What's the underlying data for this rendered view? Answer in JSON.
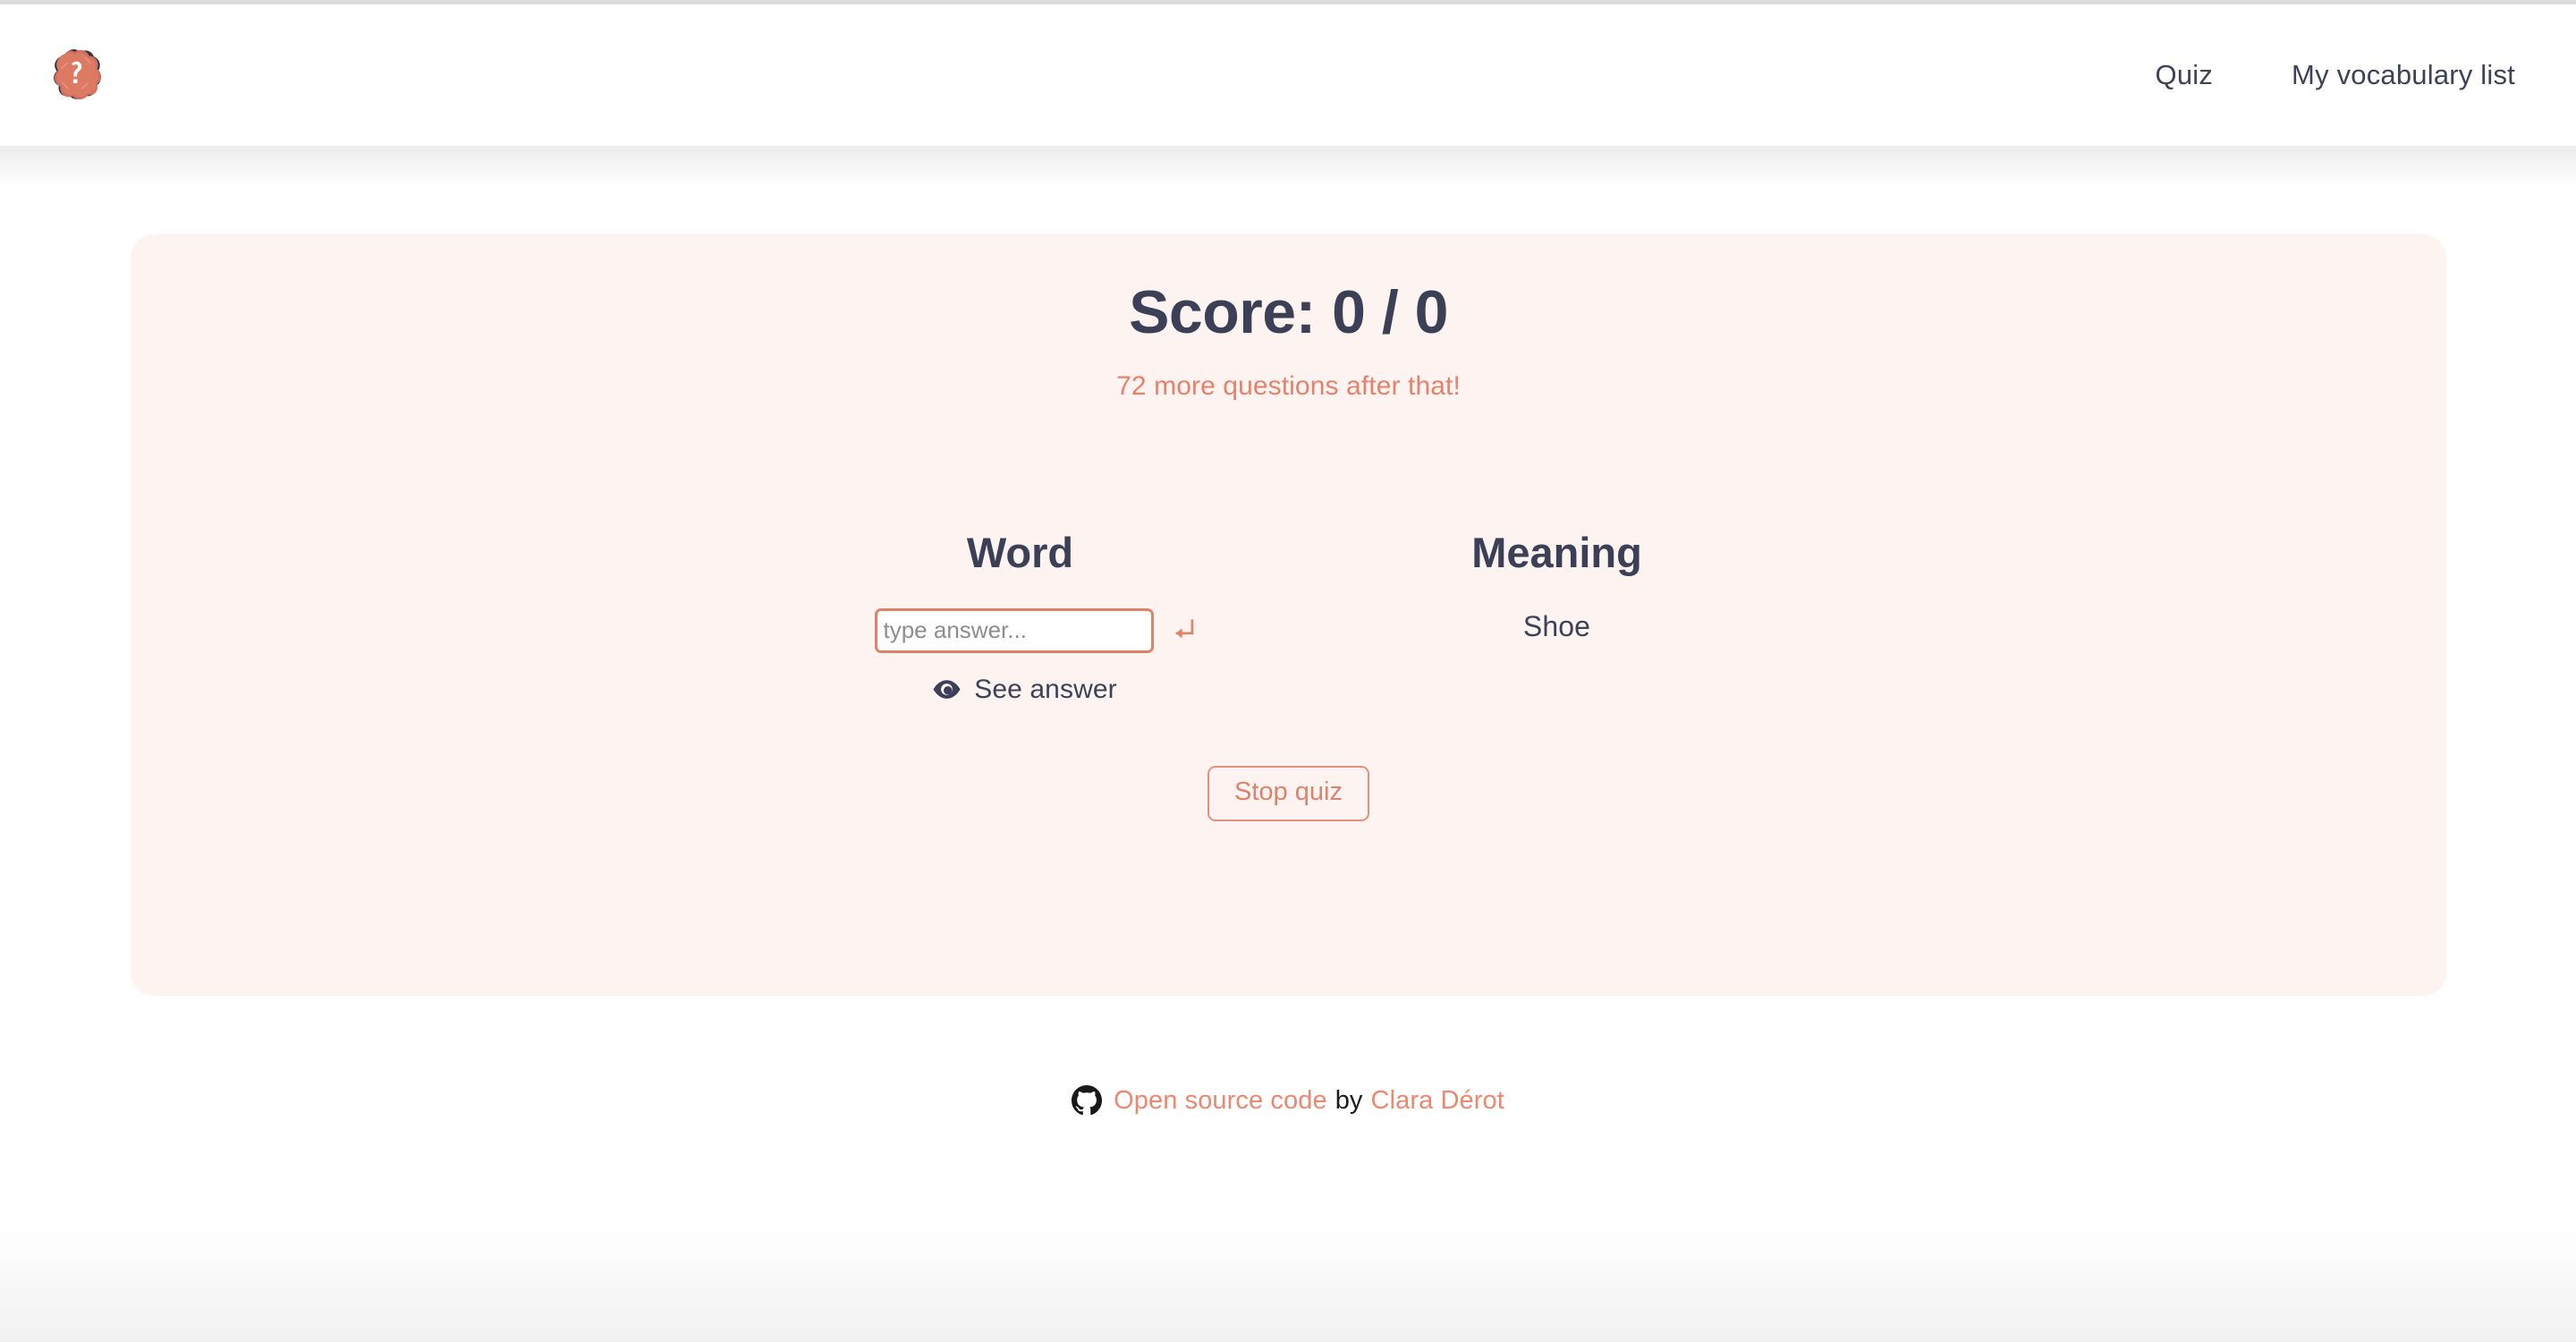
{
  "header": {
    "logo_alt": "question-mark-logo",
    "nav": [
      {
        "label": "Quiz",
        "name": "nav-quiz"
      },
      {
        "label": "My vocabulary list",
        "name": "nav-vocabulary-list"
      }
    ]
  },
  "quiz": {
    "score_label": "Score: 0 / 0",
    "score_correct": 0,
    "score_total": 0,
    "remaining_text": "72 more questions after that!",
    "remaining_count": 72,
    "word": {
      "heading": "Word",
      "input_value": "",
      "input_placeholder": "type answer...",
      "enter_hint_icon": "enter-return-arrow-icon",
      "see_answer_label": "See answer",
      "see_answer_icon": "eye-icon"
    },
    "meaning": {
      "heading": "Meaning",
      "value": "Shoe"
    },
    "stop_label": "Stop quiz"
  },
  "footer": {
    "github_icon": "github-icon",
    "link_label": "Open source code",
    "by_label": "by",
    "author_label": "Clara Dérot"
  },
  "colors": {
    "accent": "#e8816b",
    "accent_border": "#e08268",
    "text_dark": "#3b4056",
    "card_bg": "#fdf4f2",
    "page_bg": "#ffffff"
  }
}
